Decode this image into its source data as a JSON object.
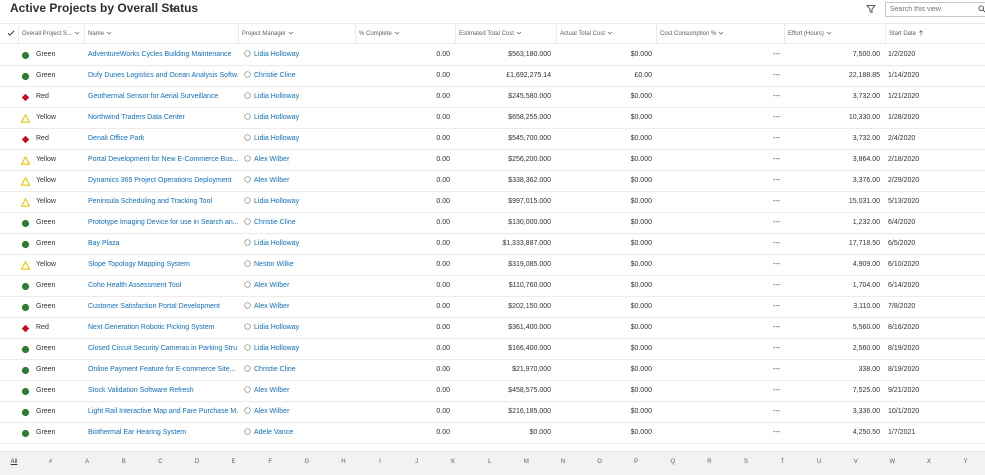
{
  "header": {
    "view_title": "Active Projects by Overall Status",
    "search_placeholder": "Search this view"
  },
  "columns": {
    "status": "Overall Project S...",
    "name": "Name",
    "pm": "Project Manager",
    "pct": "% Complete",
    "etc": "Estimated Total Cost",
    "atc": "Actual Total Cost",
    "cc": "Cost Consumption %",
    "eff": "Effort (Hours)",
    "sd": "Start Date"
  },
  "colors": {
    "green": "#2e7d32",
    "red": "#c50f1f",
    "yellow": "#e8c600",
    "link": "#106ebe"
  },
  "rows": [
    {
      "status": "Green",
      "name": "AdventureWorks Cycles Building Maintenance",
      "pm": "Lidia Holloway",
      "pct": "0.00",
      "etc": "$563,180.000",
      "atc": "$0.000",
      "cc": "---",
      "eff": "7,500.00",
      "sd": "1/2/2020"
    },
    {
      "status": "Green",
      "name": "Dufy Dunes Logistics and Ocean Analysis Softw...",
      "pm": "Christie Cline",
      "pct": "0.00",
      "etc": "£1,692,275.14",
      "atc": "£0.00",
      "cc": "---",
      "eff": "22,188.85",
      "sd": "1/14/2020"
    },
    {
      "status": "Red",
      "name": "Geothermal Sensor for Aerial Surveillance",
      "pm": "Lidia Holloway",
      "pct": "0.00",
      "etc": "$245,580.000",
      "atc": "$0.000",
      "cc": "---",
      "eff": "3,732.00",
      "sd": "1/21/2020"
    },
    {
      "status": "Yellow",
      "name": "Northwind Traders Data Center",
      "pm": "Lidia Holloway",
      "pct": "0.00",
      "etc": "$658,255.000",
      "atc": "$0.000",
      "cc": "---",
      "eff": "10,330.00",
      "sd": "1/28/2020"
    },
    {
      "status": "Red",
      "name": "Denali Office Park",
      "pm": "Lidia Holloway",
      "pct": "0.00",
      "etc": "$545,700.000",
      "atc": "$0.000",
      "cc": "---",
      "eff": "3,732.00",
      "sd": "2/4/2020"
    },
    {
      "status": "Yellow",
      "name": "Portal Development for New E-Commerce Bus...",
      "pm": "Alex Wilber",
      "pct": "0.00",
      "etc": "$256,200.000",
      "atc": "$0.000",
      "cc": "---",
      "eff": "3,864.00",
      "sd": "2/18/2020"
    },
    {
      "status": "Yellow",
      "name": "Dynamics 365 Project Operations Deployment",
      "pm": "Alex Wilber",
      "pct": "0.00",
      "etc": "$338,362.000",
      "atc": "$0.000",
      "cc": "---",
      "eff": "3,376.00",
      "sd": "2/29/2020"
    },
    {
      "status": "Yellow",
      "name": "Peninsula Scheduling and Tracking Tool",
      "pm": "Lidia Holloway",
      "pct": "0.00",
      "etc": "$997,015.000",
      "atc": "$0.000",
      "cc": "---",
      "eff": "15,031.00",
      "sd": "5/13/2020"
    },
    {
      "status": "Green",
      "name": "Prototype Imaging Device for use in Search an...",
      "pm": "Christie Cline",
      "pct": "0.00",
      "etc": "$130,000.000",
      "atc": "$0.000",
      "cc": "---",
      "eff": "1,232.00",
      "sd": "6/4/2020"
    },
    {
      "status": "Green",
      "name": "Bay Plaza",
      "pm": "Lidia Holloway",
      "pct": "0.00",
      "etc": "$1,333,887.000",
      "atc": "$0.000",
      "cc": "---",
      "eff": "17,718.50",
      "sd": "6/5/2020"
    },
    {
      "status": "Yellow",
      "name": "Slope Topology Mapping System",
      "pm": "Nestor Wilke",
      "pct": "0.00",
      "etc": "$319,085.000",
      "atc": "$0.000",
      "cc": "---",
      "eff": "4,909.00",
      "sd": "6/10/2020"
    },
    {
      "status": "Green",
      "name": "Coho Health Assessment Tool",
      "pm": "Alex Wilber",
      "pct": "0.00",
      "etc": "$110,760.000",
      "atc": "$0.000",
      "cc": "---",
      "eff": "1,704.00",
      "sd": "6/14/2020"
    },
    {
      "status": "Green",
      "name": "Customer Satisfaction Portal Development",
      "pm": "Alex Wilber",
      "pct": "0.00",
      "etc": "$202,150.000",
      "atc": "$0.000",
      "cc": "---",
      "eff": "3,110.00",
      "sd": "7/8/2020"
    },
    {
      "status": "Red",
      "name": "Next Generation Robotic Picking System",
      "pm": "Lidia Holloway",
      "pct": "0.00",
      "etc": "$361,400.000",
      "atc": "$0.000",
      "cc": "---",
      "eff": "5,560.00",
      "sd": "8/16/2020"
    },
    {
      "status": "Green",
      "name": "Closed Circuit Security Cameras in Parking Stru...",
      "pm": "Lidia Holloway",
      "pct": "0.00",
      "etc": "$166,400.000",
      "atc": "$0.000",
      "cc": "---",
      "eff": "2,560.00",
      "sd": "8/19/2020"
    },
    {
      "status": "Green",
      "name": "Online Payment Feature for E-commerce Site...",
      "pm": "Christie Cline",
      "pct": "0.00",
      "etc": "$21,970.000",
      "atc": "$0.000",
      "cc": "---",
      "eff": "338.00",
      "sd": "8/19/2020"
    },
    {
      "status": "Green",
      "name": "Stock Validation Software Refresh",
      "pm": "Alex Wilber",
      "pct": "0.00",
      "etc": "$458,575.000",
      "atc": "$0.000",
      "cc": "---",
      "eff": "7,525.00",
      "sd": "9/21/2020"
    },
    {
      "status": "Green",
      "name": "Light Rail Interactive Map and Fare Purchase M...",
      "pm": "Alex Wilber",
      "pct": "0.00",
      "etc": "$216,185.000",
      "atc": "$0.000",
      "cc": "---",
      "eff": "3,336.00",
      "sd": "10/1/2020"
    },
    {
      "status": "Green",
      "name": "Biothermal Ear Hearing System",
      "pm": "Adele Vance",
      "pct": "0.00",
      "etc": "$0.000",
      "atc": "$0.000",
      "cc": "---",
      "eff": "4,250.50",
      "sd": "1/7/2021"
    }
  ],
  "alphabet": [
    "All",
    "#",
    "A",
    "B",
    "C",
    "D",
    "E",
    "F",
    "G",
    "H",
    "I",
    "J",
    "K",
    "L",
    "M",
    "N",
    "O",
    "P",
    "Q",
    "R",
    "S",
    "T",
    "U",
    "V",
    "W",
    "X",
    "Y"
  ]
}
